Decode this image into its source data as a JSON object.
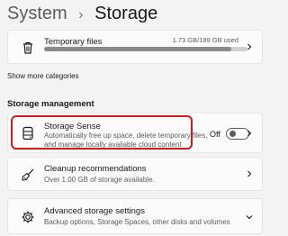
{
  "header": {
    "parent": "System",
    "separator": "›",
    "current": "Storage"
  },
  "temporary_files": {
    "title": "Temporary files",
    "usage": "1.73 GB/189 GB used",
    "fraction": 0.92
  },
  "show_more_label": "Show more categories",
  "storage_management": {
    "section_title": "Storage management",
    "storage_sense": {
      "title": "Storage Sense",
      "desc_line1": "Automatically free up space, delete temporary files,",
      "desc_line2": "and manage locally available cloud content",
      "toggle_label": "Off",
      "toggle_on": false
    },
    "cleanup": {
      "title": "Cleanup recommendations",
      "desc": "Over 1.00 GB of storage available."
    },
    "advanced": {
      "title": "Advanced storage settings",
      "desc": "Backup options, Storage Spaces, other disks and volumes"
    }
  },
  "colors": {
    "highlight": "#cc1b22",
    "background": "#f3f3f3",
    "card": "#fbfbfb"
  }
}
